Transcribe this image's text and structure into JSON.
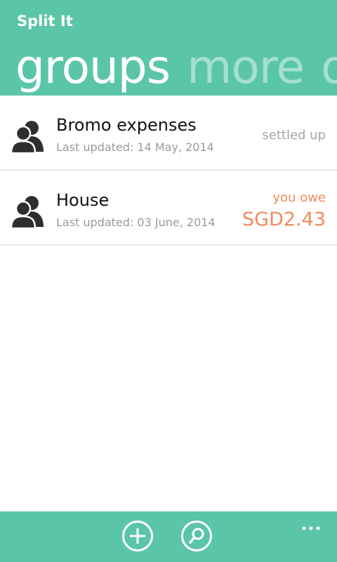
{
  "app": {
    "title": "Split It"
  },
  "pivot": {
    "tabs": [
      {
        "label": "groups"
      },
      {
        "label": "more"
      },
      {
        "label": "d"
      }
    ]
  },
  "groups": [
    {
      "name": "Bromo expenses",
      "updated": "Last updated: 14 May, 2014",
      "status": "settled up",
      "amount": ""
    },
    {
      "name": "House",
      "updated": "Last updated: 03 June, 2014",
      "status": "you owe",
      "amount": "SGD2.43"
    }
  ],
  "appbar": {
    "buttons": [
      {
        "icon": "add-circle-icon"
      },
      {
        "icon": "search-icon"
      }
    ],
    "more_icon": "ellipsis-icon"
  },
  "colors": {
    "accent": "#5bc6a6",
    "owe": "#f08a5d",
    "muted": "#9a9a9a"
  }
}
